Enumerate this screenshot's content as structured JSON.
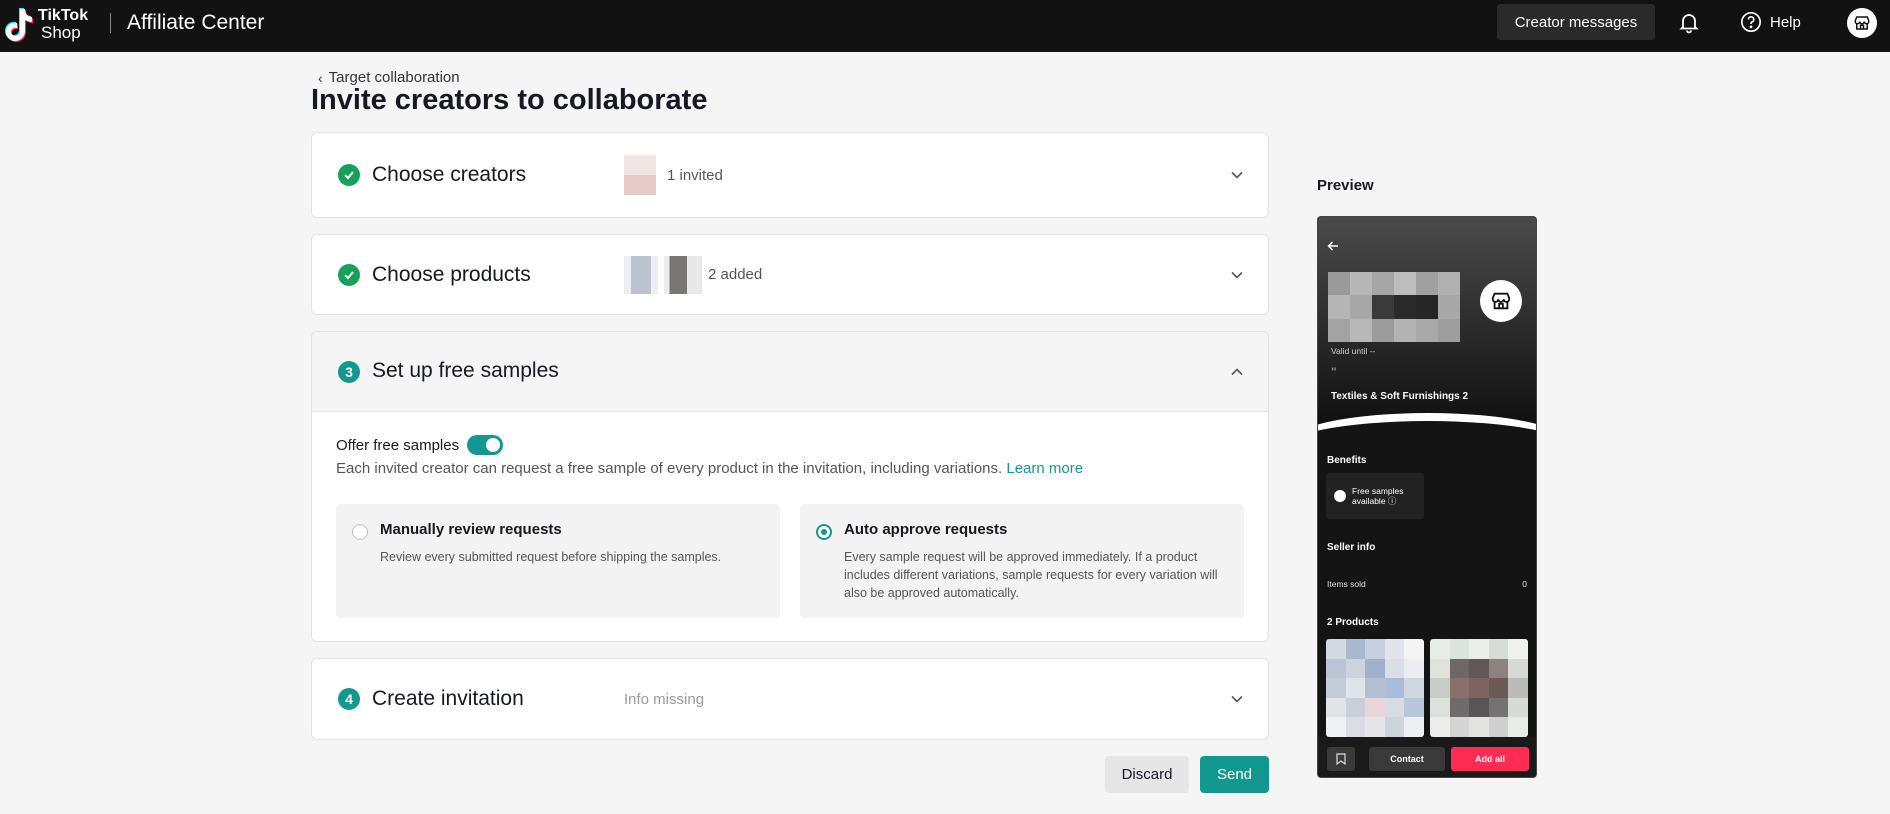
{
  "topbar": {
    "logo_line1": "TikTok",
    "logo_line2": "Shop",
    "app_title": "Affiliate Center",
    "creator_messages": "Creator messages",
    "help": "Help",
    "bg_color": "#121212"
  },
  "header": {
    "breadcrumb": "Target collaboration",
    "title": "Invite creators to collaborate"
  },
  "steps": {
    "creators": {
      "title": "Choose creators",
      "meta": "1 invited",
      "status": "done"
    },
    "products": {
      "title": "Choose products",
      "meta": "2 added",
      "status": "done"
    },
    "samples": {
      "number": "3",
      "title": "Set up free samples",
      "offer_label": "Offer free samples",
      "offer_enabled": true,
      "description": "Each invited creator can request a free sample of every product in the invitation, including variations.",
      "learn_more": "Learn more",
      "options": [
        {
          "title": "Manually review requests",
          "desc": "Review every submitted request before shipping the samples.",
          "selected": false
        },
        {
          "title": "Auto approve requests",
          "desc": "Every sample request will be approved immediately. If a product includes different variations, sample requests for every variation will also be approved automatically.",
          "selected": true
        }
      ]
    },
    "invitation": {
      "number": "4",
      "title": "Create invitation",
      "meta": "Info missing"
    }
  },
  "actions": {
    "discard": "Discard",
    "send": "Send"
  },
  "preview": {
    "label": "Preview",
    "valid_until": "Valid until --",
    "quote_mark": "\"",
    "category": "Textiles & Soft Furnishings 2",
    "benefits_heading": "Benefits",
    "benefit_chip": "Free samples available ⓘ",
    "seller_info_heading": "Seller info",
    "items_sold_label": "Items sold",
    "items_sold_value": "0",
    "products_heading": "2 Products",
    "contact": "Contact",
    "add_all": "Add all"
  },
  "colors": {
    "accent": "#139891",
    "success": "#16a05c",
    "cta": "#fe2c55"
  }
}
